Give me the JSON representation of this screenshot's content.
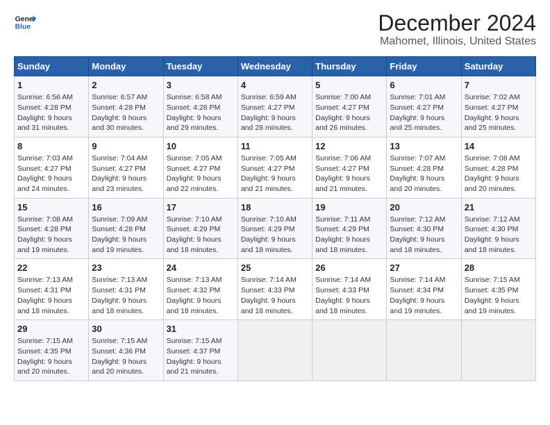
{
  "logo": {
    "line1": "General",
    "line2": "Blue"
  },
  "title": "December 2024",
  "subtitle": "Mahomet, Illinois, United States",
  "days_of_week": [
    "Sunday",
    "Monday",
    "Tuesday",
    "Wednesday",
    "Thursday",
    "Friday",
    "Saturday"
  ],
  "weeks": [
    [
      {
        "day": 1,
        "sunrise": "Sunrise: 6:56 AM",
        "sunset": "Sunset: 4:28 PM",
        "daylight": "Daylight: 9 hours and 31 minutes."
      },
      {
        "day": 2,
        "sunrise": "Sunrise: 6:57 AM",
        "sunset": "Sunset: 4:28 PM",
        "daylight": "Daylight: 9 hours and 30 minutes."
      },
      {
        "day": 3,
        "sunrise": "Sunrise: 6:58 AM",
        "sunset": "Sunset: 4:28 PM",
        "daylight": "Daylight: 9 hours and 29 minutes."
      },
      {
        "day": 4,
        "sunrise": "Sunrise: 6:59 AM",
        "sunset": "Sunset: 4:27 PM",
        "daylight": "Daylight: 9 hours and 28 minutes."
      },
      {
        "day": 5,
        "sunrise": "Sunrise: 7:00 AM",
        "sunset": "Sunset: 4:27 PM",
        "daylight": "Daylight: 9 hours and 26 minutes."
      },
      {
        "day": 6,
        "sunrise": "Sunrise: 7:01 AM",
        "sunset": "Sunset: 4:27 PM",
        "daylight": "Daylight: 9 hours and 25 minutes."
      },
      {
        "day": 7,
        "sunrise": "Sunrise: 7:02 AM",
        "sunset": "Sunset: 4:27 PM",
        "daylight": "Daylight: 9 hours and 25 minutes."
      }
    ],
    [
      {
        "day": 8,
        "sunrise": "Sunrise: 7:03 AM",
        "sunset": "Sunset: 4:27 PM",
        "daylight": "Daylight: 9 hours and 24 minutes."
      },
      {
        "day": 9,
        "sunrise": "Sunrise: 7:04 AM",
        "sunset": "Sunset: 4:27 PM",
        "daylight": "Daylight: 9 hours and 23 minutes."
      },
      {
        "day": 10,
        "sunrise": "Sunrise: 7:05 AM",
        "sunset": "Sunset: 4:27 PM",
        "daylight": "Daylight: 9 hours and 22 minutes."
      },
      {
        "day": 11,
        "sunrise": "Sunrise: 7:05 AM",
        "sunset": "Sunset: 4:27 PM",
        "daylight": "Daylight: 9 hours and 21 minutes."
      },
      {
        "day": 12,
        "sunrise": "Sunrise: 7:06 AM",
        "sunset": "Sunset: 4:27 PM",
        "daylight": "Daylight: 9 hours and 21 minutes."
      },
      {
        "day": 13,
        "sunrise": "Sunrise: 7:07 AM",
        "sunset": "Sunset: 4:28 PM",
        "daylight": "Daylight: 9 hours and 20 minutes."
      },
      {
        "day": 14,
        "sunrise": "Sunrise: 7:08 AM",
        "sunset": "Sunset: 4:28 PM",
        "daylight": "Daylight: 9 hours and 20 minutes."
      }
    ],
    [
      {
        "day": 15,
        "sunrise": "Sunrise: 7:08 AM",
        "sunset": "Sunset: 4:28 PM",
        "daylight": "Daylight: 9 hours and 19 minutes."
      },
      {
        "day": 16,
        "sunrise": "Sunrise: 7:09 AM",
        "sunset": "Sunset: 4:28 PM",
        "daylight": "Daylight: 9 hours and 19 minutes."
      },
      {
        "day": 17,
        "sunrise": "Sunrise: 7:10 AM",
        "sunset": "Sunset: 4:29 PM",
        "daylight": "Daylight: 9 hours and 18 minutes."
      },
      {
        "day": 18,
        "sunrise": "Sunrise: 7:10 AM",
        "sunset": "Sunset: 4:29 PM",
        "daylight": "Daylight: 9 hours and 18 minutes."
      },
      {
        "day": 19,
        "sunrise": "Sunrise: 7:11 AM",
        "sunset": "Sunset: 4:29 PM",
        "daylight": "Daylight: 9 hours and 18 minutes."
      },
      {
        "day": 20,
        "sunrise": "Sunrise: 7:12 AM",
        "sunset": "Sunset: 4:30 PM",
        "daylight": "Daylight: 9 hours and 18 minutes."
      },
      {
        "day": 21,
        "sunrise": "Sunrise: 7:12 AM",
        "sunset": "Sunset: 4:30 PM",
        "daylight": "Daylight: 9 hours and 18 minutes."
      }
    ],
    [
      {
        "day": 22,
        "sunrise": "Sunrise: 7:13 AM",
        "sunset": "Sunset: 4:31 PM",
        "daylight": "Daylight: 9 hours and 18 minutes."
      },
      {
        "day": 23,
        "sunrise": "Sunrise: 7:13 AM",
        "sunset": "Sunset: 4:31 PM",
        "daylight": "Daylight: 9 hours and 18 minutes."
      },
      {
        "day": 24,
        "sunrise": "Sunrise: 7:13 AM",
        "sunset": "Sunset: 4:32 PM",
        "daylight": "Daylight: 9 hours and 18 minutes."
      },
      {
        "day": 25,
        "sunrise": "Sunrise: 7:14 AM",
        "sunset": "Sunset: 4:33 PM",
        "daylight": "Daylight: 9 hours and 18 minutes."
      },
      {
        "day": 26,
        "sunrise": "Sunrise: 7:14 AM",
        "sunset": "Sunset: 4:33 PM",
        "daylight": "Daylight: 9 hours and 18 minutes."
      },
      {
        "day": 27,
        "sunrise": "Sunrise: 7:14 AM",
        "sunset": "Sunset: 4:34 PM",
        "daylight": "Daylight: 9 hours and 19 minutes."
      },
      {
        "day": 28,
        "sunrise": "Sunrise: 7:15 AM",
        "sunset": "Sunset: 4:35 PM",
        "daylight": "Daylight: 9 hours and 19 minutes."
      }
    ],
    [
      {
        "day": 29,
        "sunrise": "Sunrise: 7:15 AM",
        "sunset": "Sunset: 4:35 PM",
        "daylight": "Daylight: 9 hours and 20 minutes."
      },
      {
        "day": 30,
        "sunrise": "Sunrise: 7:15 AM",
        "sunset": "Sunset: 4:36 PM",
        "daylight": "Daylight: 9 hours and 20 minutes."
      },
      {
        "day": 31,
        "sunrise": "Sunrise: 7:15 AM",
        "sunset": "Sunset: 4:37 PM",
        "daylight": "Daylight: 9 hours and 21 minutes."
      },
      null,
      null,
      null,
      null
    ]
  ]
}
